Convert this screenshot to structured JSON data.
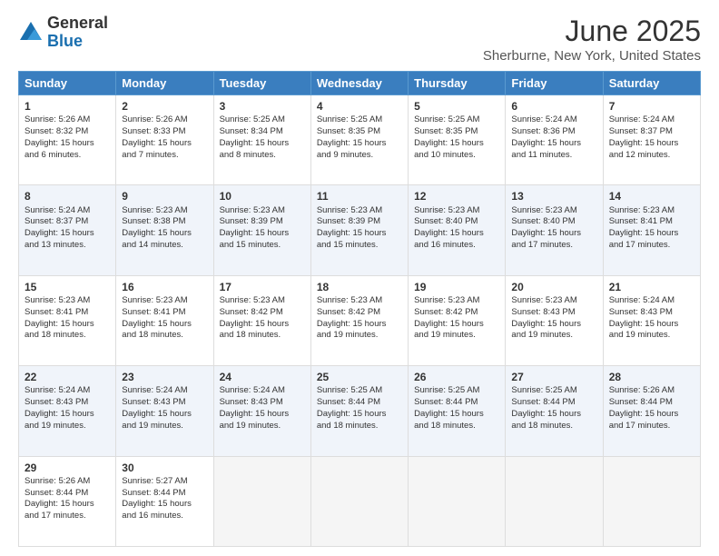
{
  "logo": {
    "line1": "General",
    "line2": "Blue"
  },
  "title": "June 2025",
  "subtitle": "Sherburne, New York, United States",
  "days_of_week": [
    "Sunday",
    "Monday",
    "Tuesday",
    "Wednesday",
    "Thursday",
    "Friday",
    "Saturday"
  ],
  "weeks": [
    [
      {
        "day": 1,
        "lines": [
          "Sunrise: 5:26 AM",
          "Sunset: 8:32 PM",
          "Daylight: 15 hours",
          "and 6 minutes."
        ]
      },
      {
        "day": 2,
        "lines": [
          "Sunrise: 5:26 AM",
          "Sunset: 8:33 PM",
          "Daylight: 15 hours",
          "and 7 minutes."
        ]
      },
      {
        "day": 3,
        "lines": [
          "Sunrise: 5:25 AM",
          "Sunset: 8:34 PM",
          "Daylight: 15 hours",
          "and 8 minutes."
        ]
      },
      {
        "day": 4,
        "lines": [
          "Sunrise: 5:25 AM",
          "Sunset: 8:35 PM",
          "Daylight: 15 hours",
          "and 9 minutes."
        ]
      },
      {
        "day": 5,
        "lines": [
          "Sunrise: 5:25 AM",
          "Sunset: 8:35 PM",
          "Daylight: 15 hours",
          "and 10 minutes."
        ]
      },
      {
        "day": 6,
        "lines": [
          "Sunrise: 5:24 AM",
          "Sunset: 8:36 PM",
          "Daylight: 15 hours",
          "and 11 minutes."
        ]
      },
      {
        "day": 7,
        "lines": [
          "Sunrise: 5:24 AM",
          "Sunset: 8:37 PM",
          "Daylight: 15 hours",
          "and 12 minutes."
        ]
      }
    ],
    [
      {
        "day": 8,
        "lines": [
          "Sunrise: 5:24 AM",
          "Sunset: 8:37 PM",
          "Daylight: 15 hours",
          "and 13 minutes."
        ]
      },
      {
        "day": 9,
        "lines": [
          "Sunrise: 5:23 AM",
          "Sunset: 8:38 PM",
          "Daylight: 15 hours",
          "and 14 minutes."
        ]
      },
      {
        "day": 10,
        "lines": [
          "Sunrise: 5:23 AM",
          "Sunset: 8:39 PM",
          "Daylight: 15 hours",
          "and 15 minutes."
        ]
      },
      {
        "day": 11,
        "lines": [
          "Sunrise: 5:23 AM",
          "Sunset: 8:39 PM",
          "Daylight: 15 hours",
          "and 15 minutes."
        ]
      },
      {
        "day": 12,
        "lines": [
          "Sunrise: 5:23 AM",
          "Sunset: 8:40 PM",
          "Daylight: 15 hours",
          "and 16 minutes."
        ]
      },
      {
        "day": 13,
        "lines": [
          "Sunrise: 5:23 AM",
          "Sunset: 8:40 PM",
          "Daylight: 15 hours",
          "and 17 minutes."
        ]
      },
      {
        "day": 14,
        "lines": [
          "Sunrise: 5:23 AM",
          "Sunset: 8:41 PM",
          "Daylight: 15 hours",
          "and 17 minutes."
        ]
      }
    ],
    [
      {
        "day": 15,
        "lines": [
          "Sunrise: 5:23 AM",
          "Sunset: 8:41 PM",
          "Daylight: 15 hours",
          "and 18 minutes."
        ]
      },
      {
        "day": 16,
        "lines": [
          "Sunrise: 5:23 AM",
          "Sunset: 8:41 PM",
          "Daylight: 15 hours",
          "and 18 minutes."
        ]
      },
      {
        "day": 17,
        "lines": [
          "Sunrise: 5:23 AM",
          "Sunset: 8:42 PM",
          "Daylight: 15 hours",
          "and 18 minutes."
        ]
      },
      {
        "day": 18,
        "lines": [
          "Sunrise: 5:23 AM",
          "Sunset: 8:42 PM",
          "Daylight: 15 hours",
          "and 19 minutes."
        ]
      },
      {
        "day": 19,
        "lines": [
          "Sunrise: 5:23 AM",
          "Sunset: 8:42 PM",
          "Daylight: 15 hours",
          "and 19 minutes."
        ]
      },
      {
        "day": 20,
        "lines": [
          "Sunrise: 5:23 AM",
          "Sunset: 8:43 PM",
          "Daylight: 15 hours",
          "and 19 minutes."
        ]
      },
      {
        "day": 21,
        "lines": [
          "Sunrise: 5:24 AM",
          "Sunset: 8:43 PM",
          "Daylight: 15 hours",
          "and 19 minutes."
        ]
      }
    ],
    [
      {
        "day": 22,
        "lines": [
          "Sunrise: 5:24 AM",
          "Sunset: 8:43 PM",
          "Daylight: 15 hours",
          "and 19 minutes."
        ]
      },
      {
        "day": 23,
        "lines": [
          "Sunrise: 5:24 AM",
          "Sunset: 8:43 PM",
          "Daylight: 15 hours",
          "and 19 minutes."
        ]
      },
      {
        "day": 24,
        "lines": [
          "Sunrise: 5:24 AM",
          "Sunset: 8:43 PM",
          "Daylight: 15 hours",
          "and 19 minutes."
        ]
      },
      {
        "day": 25,
        "lines": [
          "Sunrise: 5:25 AM",
          "Sunset: 8:44 PM",
          "Daylight: 15 hours",
          "and 18 minutes."
        ]
      },
      {
        "day": 26,
        "lines": [
          "Sunrise: 5:25 AM",
          "Sunset: 8:44 PM",
          "Daylight: 15 hours",
          "and 18 minutes."
        ]
      },
      {
        "day": 27,
        "lines": [
          "Sunrise: 5:25 AM",
          "Sunset: 8:44 PM",
          "Daylight: 15 hours",
          "and 18 minutes."
        ]
      },
      {
        "day": 28,
        "lines": [
          "Sunrise: 5:26 AM",
          "Sunset: 8:44 PM",
          "Daylight: 15 hours",
          "and 17 minutes."
        ]
      }
    ],
    [
      {
        "day": 29,
        "lines": [
          "Sunrise: 5:26 AM",
          "Sunset: 8:44 PM",
          "Daylight: 15 hours",
          "and 17 minutes."
        ]
      },
      {
        "day": 30,
        "lines": [
          "Sunrise: 5:27 AM",
          "Sunset: 8:44 PM",
          "Daylight: 15 hours",
          "and 16 minutes."
        ]
      },
      null,
      null,
      null,
      null,
      null
    ]
  ]
}
